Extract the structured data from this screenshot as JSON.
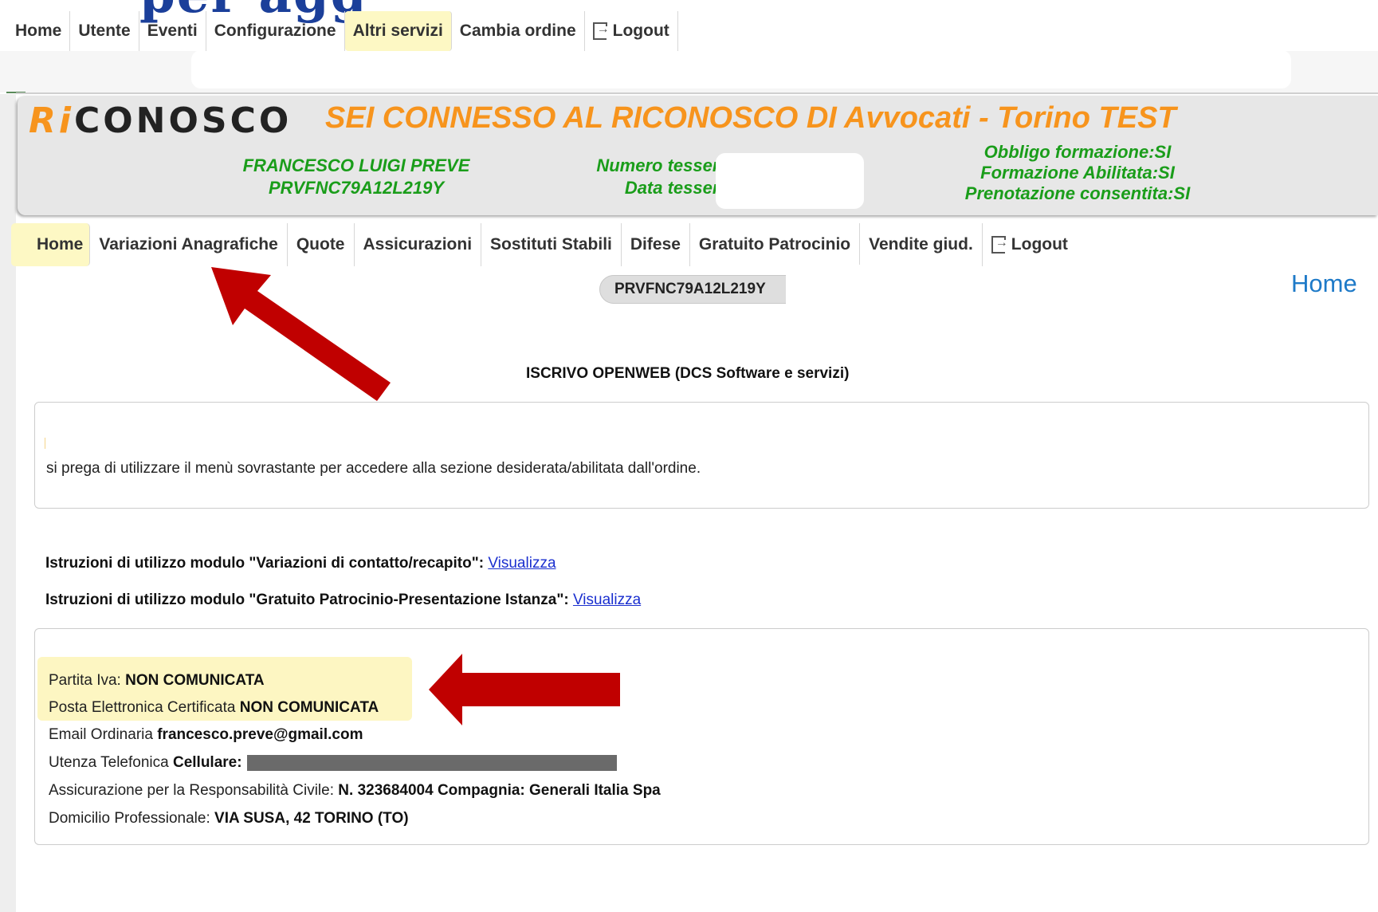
{
  "colors": {
    "accent_orange": "#f7941d",
    "green_text": "#1a9d1a",
    "highlight_yellow": "#fdf8c4",
    "arrow_red": "#c00000",
    "link_blue": "#1a2fcf",
    "home_blue": "#1e7ac8"
  },
  "top_nav": {
    "items": [
      "Home",
      "Utente",
      "Eventi",
      "Configurazione",
      "Altri servizi",
      "Cambia ordine"
    ],
    "active": "Altri servizi",
    "logout_label": "Logout",
    "logout_icon": "logout-icon"
  },
  "header": {
    "logo_ri": "Ri",
    "logo_rest": "CONOSCO",
    "connected": "SEI CONNESSO AL RICONOSCO DI  Avvocati - Torino TEST",
    "user_name": "FRANCESCO LUIGI  PREVE",
    "user_code": "PRVFNC79A12L219Y",
    "numero_tessera": "Numero tessera:",
    "data_tessera": "Data tessera:",
    "obbligo": "Obbligo formazione:SI",
    "formazione": "Formazione Abilitata:SI",
    "prenotazione": "Prenotazione consentita:SI"
  },
  "nav2": {
    "items": [
      "Home",
      "Variazioni Anagrafiche",
      "Quote",
      "Assicurazioni",
      "Sostituti Stabili",
      "Difese",
      "Gratuito Patrocinio",
      "Vendite giud."
    ],
    "active": "Home",
    "logout_label": "Logout"
  },
  "main": {
    "code": "PRVFNC79A12L219Y",
    "page_label": "Home",
    "section_title": "ISCRIVO OPENWEB (DCS Software e servizi)",
    "message": "si prega di utilizzare il menù sovrastante per accedere alla sezione desiderata/abilitata dall'ordine.",
    "instr1_label": "Istruzioni di utilizzo modulo \"Variazioni di contatto/recapito\":",
    "instr2_label": "Istruzioni di utilizzo modulo \"Gratuito Patrocinio-Presentazione Istanza\":",
    "view_link": "Visualizza"
  },
  "info": {
    "piva_label": "Partita Iva:",
    "piva_value": "NON COMUNICATA",
    "pec_label": "Posta Elettronica Certificata",
    "pec_value": "NON COMUNICATA",
    "email_label": "Email Ordinaria",
    "email_value": "francesco.preve@gmail.com",
    "tel_label": "Utenza Telefonica",
    "tel_value": "Cellulare:",
    "ins_label": "Assicurazione per la Responsabilità Civile:",
    "ins_value": "N. 323684004 Compagnia: Generali Italia Spa",
    "dom_label": "Domicilio Professionale:",
    "dom_value": "VIA SUSA, 42 TORINO (TO)"
  }
}
